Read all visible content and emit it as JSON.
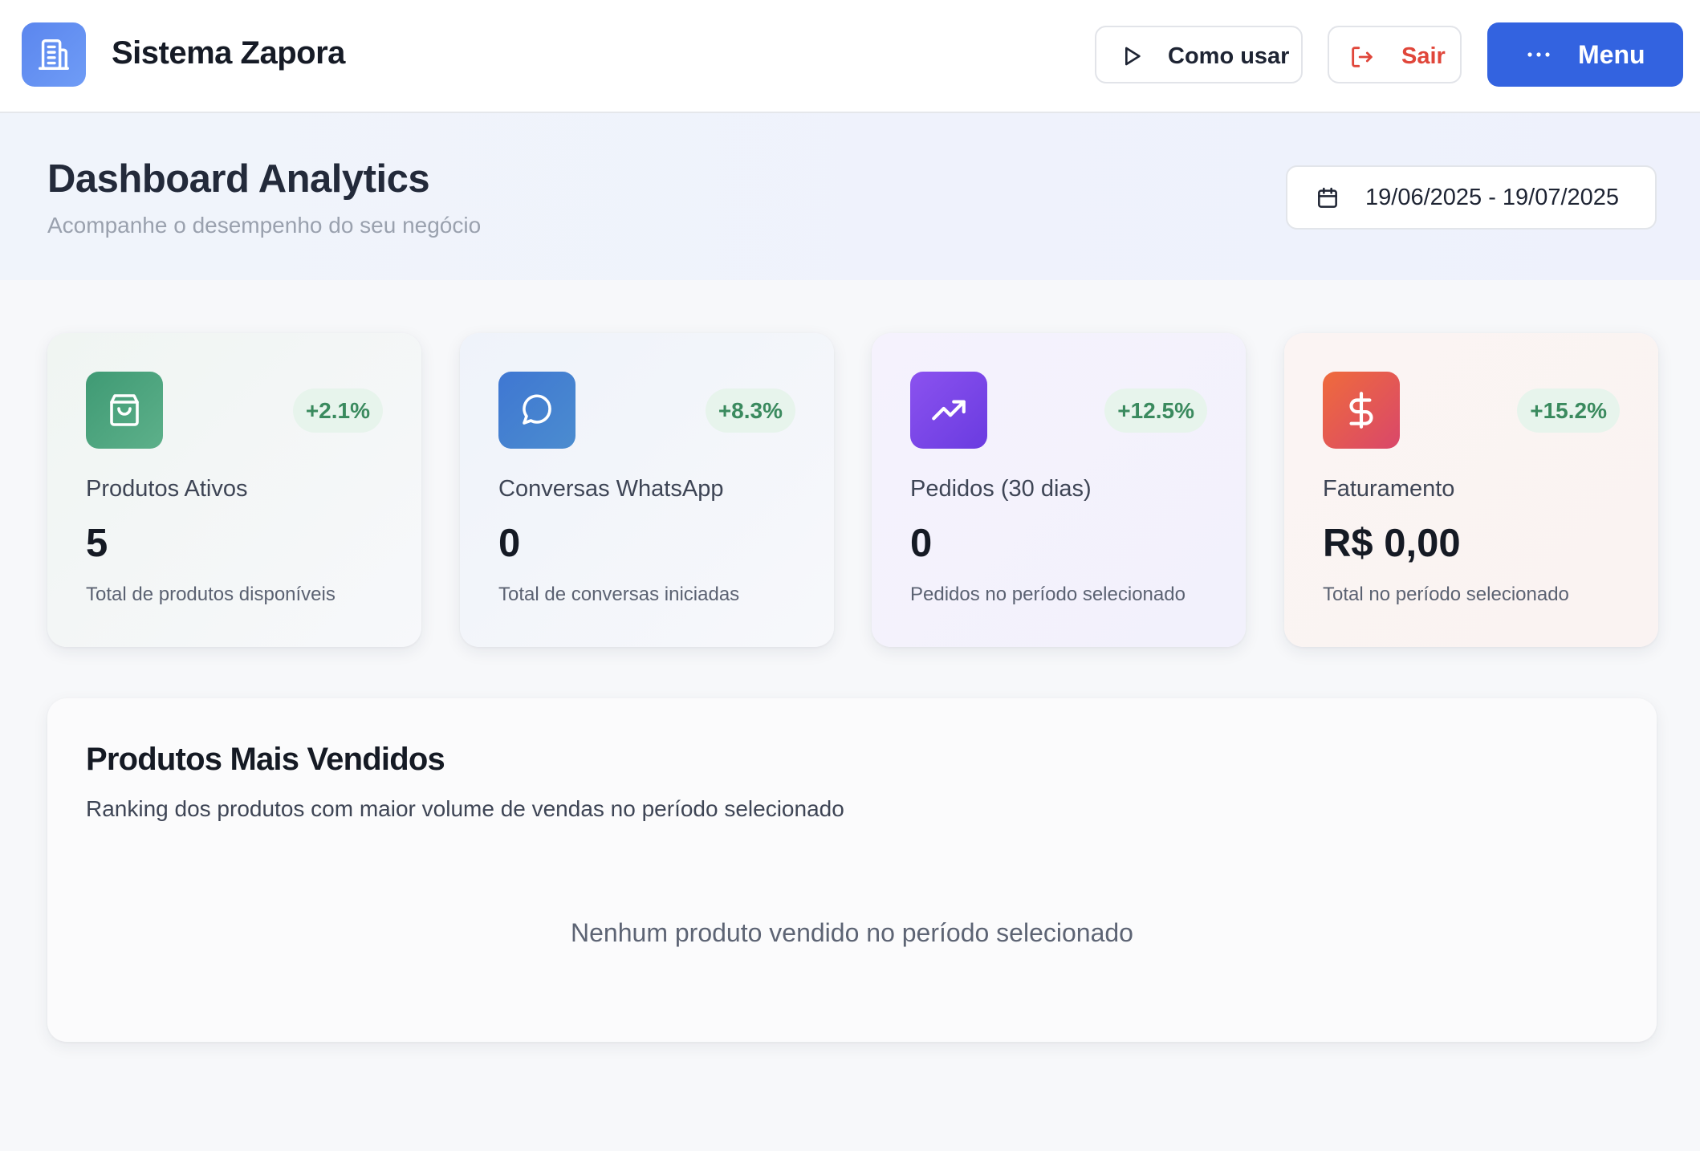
{
  "header": {
    "app_title": "Sistema Zapora",
    "logo_icon": "building-icon",
    "buttons": {
      "how_to": {
        "label": "Como usar",
        "icon": "play-icon"
      },
      "exit": {
        "label": "Sair",
        "icon": "logout-icon",
        "color": "#e0463a"
      },
      "menu": {
        "label": "Menu",
        "icon": "ellipsis-icon",
        "color": "#3363e0"
      }
    }
  },
  "hero": {
    "title": "Dashboard Analytics",
    "subtitle": "Acompanhe o desempenho do seu negócio",
    "date_range": {
      "label": "19/06/2025 - 19/07/2025",
      "icon": "calendar-icon"
    }
  },
  "stats": [
    {
      "icon": "shopping-bag-icon",
      "badge": "+2.1%",
      "title": "Produtos Ativos",
      "value": "5",
      "description": "Total de produtos disponíveis",
      "color": "#3f9a74"
    },
    {
      "icon": "chat-bubble-icon",
      "badge": "+8.3%",
      "title": "Conversas WhatsApp",
      "value": "0",
      "description": "Total de conversas iniciadas",
      "color": "#3f77d2"
    },
    {
      "icon": "trending-up-icon",
      "badge": "+12.5%",
      "title": "Pedidos (30 dias)",
      "value": "0",
      "description": "Pedidos no período selecionado",
      "color": "#7b45e8"
    },
    {
      "icon": "dollar-icon",
      "badge": "+15.2%",
      "title": "Faturamento",
      "value": "R$ 0,00",
      "description": "Total no período selecionado",
      "color": "#e35a52"
    }
  ],
  "top_products": {
    "title": "Produtos Mais Vendidos",
    "subtitle": "Ranking dos produtos com maior volume de vendas no período selecionado",
    "empty_message": "Nenhum produto vendido no período selecionado"
  },
  "colors": {
    "badge_positive": "#3a8a5e",
    "accent": "#3363e0"
  }
}
